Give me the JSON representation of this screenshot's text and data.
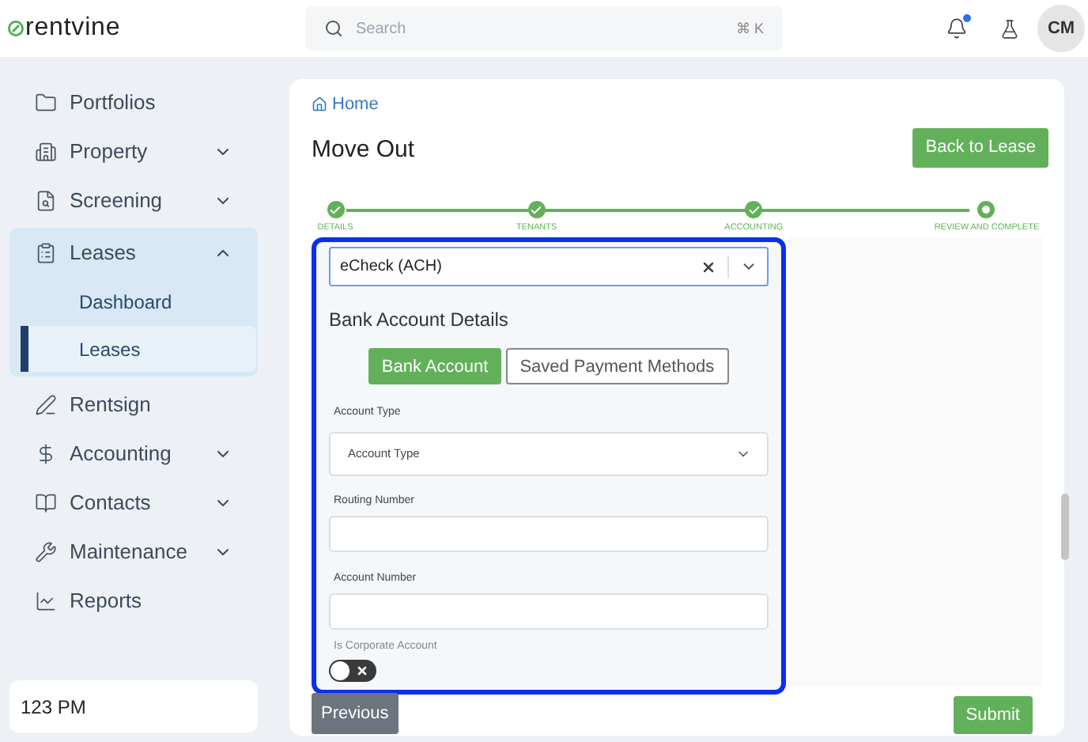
{
  "header": {
    "logo": "rentvine",
    "search": {
      "placeholder": "Search",
      "shortcut": "⌘ K"
    },
    "notifications": {
      "unread": true
    },
    "avatar": "CM"
  },
  "sidebar": {
    "items": [
      {
        "label": "Portfolios"
      },
      {
        "label": "Property",
        "expanded": false
      },
      {
        "label": "Screening",
        "expanded": false
      },
      {
        "label": "Leases",
        "expanded": true,
        "children": [
          {
            "label": "Dashboard",
            "selected": false
          },
          {
            "label": "Leases",
            "selected": true
          }
        ]
      },
      {
        "label": "Rentsign"
      },
      {
        "label": "Accounting",
        "expanded": false
      },
      {
        "label": "Contacts",
        "expanded": false
      },
      {
        "label": "Maintenance",
        "expanded": false
      },
      {
        "label": "Reports"
      }
    ],
    "footer": "123 PM"
  },
  "breadcrumb": "Home",
  "title": "Move Out",
  "back_button": "Back to Lease",
  "steps": [
    {
      "label": "DETAILS",
      "completed": true
    },
    {
      "label": "TENANTS",
      "completed": true
    },
    {
      "label": "ACCOUNTING",
      "completed": true
    },
    {
      "label": "REVIEW AND COMPLETE",
      "completed": false
    }
  ],
  "payment_method": {
    "value": "eCheck (ACH)"
  },
  "section_title": "Bank Account Details",
  "source_tabs": [
    {
      "label": "Bank Account",
      "selected": true
    },
    {
      "label": "Saved Payment Methods",
      "selected": false
    }
  ],
  "fields": [
    {
      "kind": "select",
      "label": "Account Type",
      "placeholder": "Account Type"
    },
    {
      "kind": "text",
      "label": "Routing Number"
    },
    {
      "kind": "text",
      "label": "Account Number"
    },
    {
      "kind": "toggle",
      "label": "Is Corporate Account",
      "on": false
    }
  ],
  "buttons": {
    "previous": "Previous",
    "submit": "Submit"
  }
}
